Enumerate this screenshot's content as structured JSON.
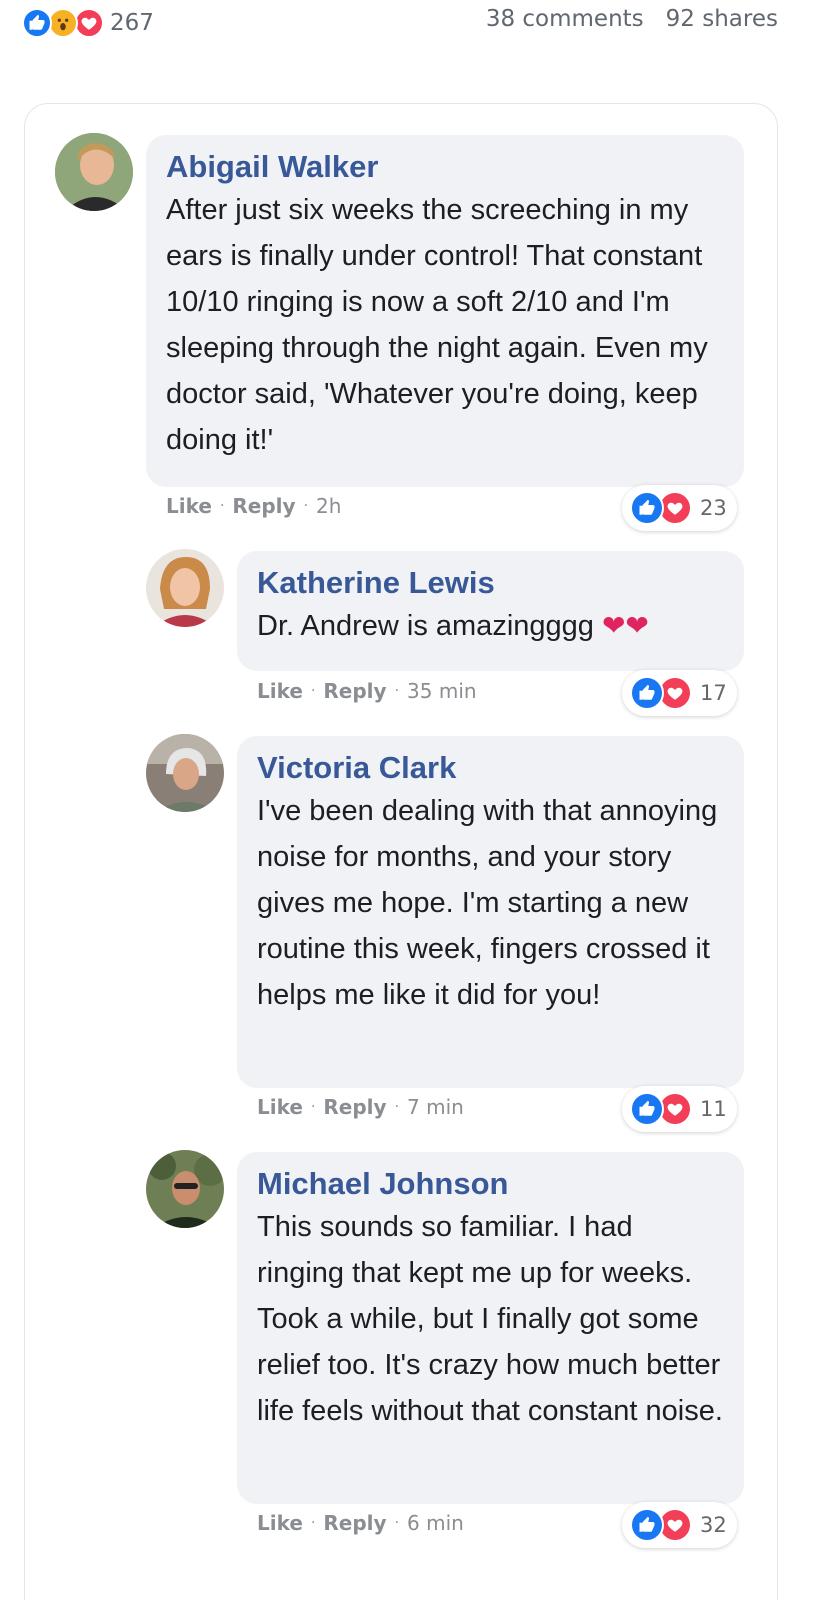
{
  "post_stats": {
    "reactions_count": "267",
    "comments": "38 comments",
    "shares": "92 shares",
    "reaction_icons": [
      "like-icon",
      "wow-icon",
      "love-icon"
    ]
  },
  "comments": [
    {
      "author": "Abigail Walker",
      "text": "After just six weeks the screeching in my ears is finally under control! That constant 10/10 ringing is now a soft 2/10 and I'm sleeping through the night again. Even my doctor said, 'Whatever you're doing, keep doing it!'",
      "like": "Like",
      "reply": "Reply",
      "time": "2h",
      "reactions": "23"
    },
    {
      "author": "Katherine Lewis",
      "text": "Dr. Andrew is amazingggg",
      "emoji": "❤❤",
      "like": "Like",
      "reply": "Reply",
      "time": "35 min",
      "reactions": "17"
    },
    {
      "author": "Victoria Clark",
      "text": "I've been dealing with that annoying noise for months, and your story gives me hope. I'm starting a new routine this week, fingers crossed it helps me like it did for you!",
      "like": "Like",
      "reply": "Reply",
      "time": "7 min",
      "reactions": "11"
    },
    {
      "author": "Michael Johnson",
      "text": "This sounds so familiar. I had ringing that kept me up for weeks. Took a while, but I finally got some relief too. It's crazy how much better life feels without that constant noise.",
      "like": "Like",
      "reply": "Reply",
      "time": "6 min",
      "reactions": "32"
    }
  ],
  "colors": {
    "author": "#385898",
    "bubble": "#f0f2f5",
    "like": "#1877f2",
    "love": "#f33e58",
    "wow": "#f7b125"
  }
}
